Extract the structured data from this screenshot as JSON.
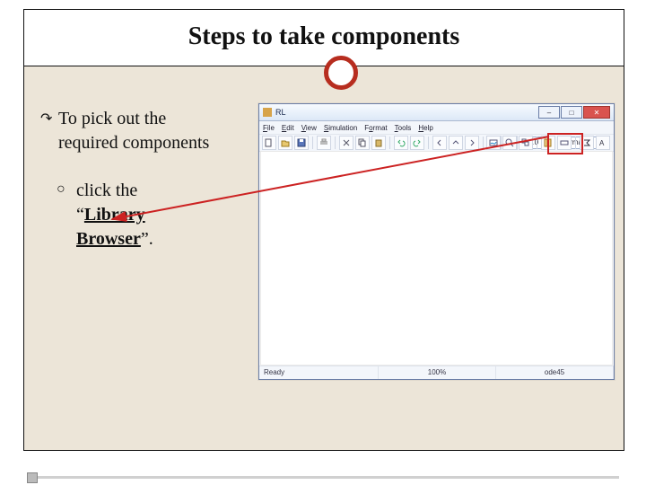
{
  "slide": {
    "title": "Steps to take components",
    "bullet1_a": "To pick out the",
    "bullet1_b": "required components",
    "sub_lead": " click the",
    "sub_quote_open": "“",
    "sub_word_library": "Library",
    "sub_word_browser": "Browser",
    "sub_quote_close": "”."
  },
  "app": {
    "title": "RL",
    "menu": [
      "File",
      "Edit",
      "View",
      "Simulation",
      "Format",
      "Tools",
      "Help"
    ],
    "toolbar_number": "10.0",
    "toolbar_select": "Normal",
    "tooltip": "Library Browser",
    "status": {
      "left": "Ready",
      "mid": "100%",
      "right": "ode45"
    }
  },
  "icons": {
    "arrow_bullet": "↷",
    "circle_bullet": "○",
    "minimize": "–",
    "maximize": "□",
    "close": "✕"
  }
}
